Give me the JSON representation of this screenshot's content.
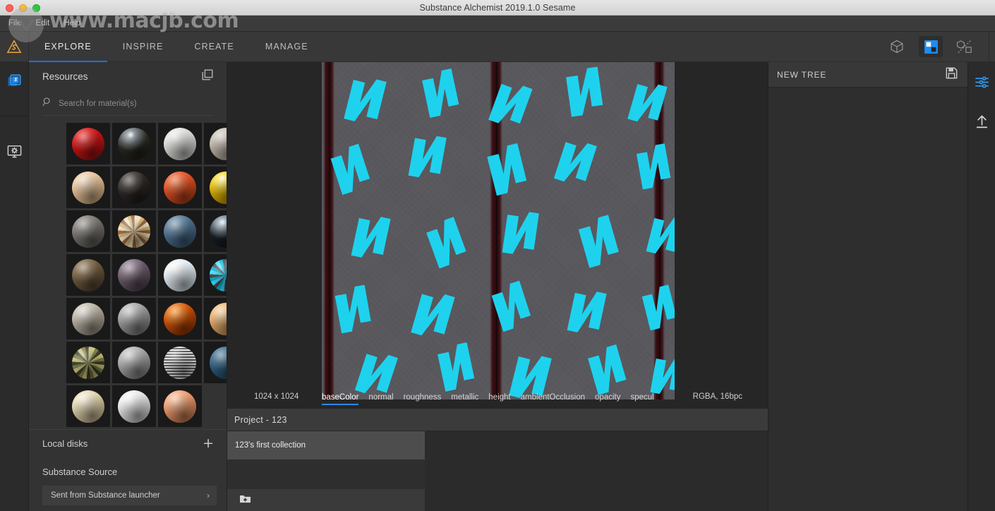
{
  "window": {
    "title": "Substance Alchemist 2019.1.0 Sesame",
    "traffic_lights": [
      "close",
      "minimize",
      "zoom"
    ]
  },
  "watermark": {
    "text": "www.macjb.com"
  },
  "menubar": {
    "items": [
      "File",
      "Edit",
      "Help"
    ]
  },
  "topnav": {
    "brand_icon": "substance-alchemist-logo",
    "tabs": [
      {
        "label": "EXPLORE",
        "active": true
      },
      {
        "label": "INSPIRE",
        "active": false
      },
      {
        "label": "CREATE",
        "active": false
      },
      {
        "label": "MANAGE",
        "active": false
      }
    ],
    "tools": [
      {
        "name": "view-3d-cube-icon",
        "active": false
      },
      {
        "name": "view-2d-texture-icon",
        "active": true
      },
      {
        "name": "view-split-3d-2d-icon",
        "active": false
      }
    ]
  },
  "left_rail": {
    "items": [
      {
        "name": "materials-library-icon",
        "active": true
      },
      {
        "name": "display-settings-icon",
        "active": false
      }
    ]
  },
  "resources": {
    "title": "Resources",
    "duplicate_icon": "duplicate-squares-icon",
    "search": {
      "placeholder": "Search for material(s)",
      "value": "",
      "icon": "search-icon"
    },
    "materials": [
      {
        "name": "red-plastic",
        "colors": [
          "#f03a3a",
          "#c21414",
          "#7a0b0b"
        ],
        "style": "smooth"
      },
      {
        "name": "dark-liquid-metal",
        "colors": [
          "#7f8b93",
          "#2b2a22",
          "#171611"
        ],
        "style": "metal"
      },
      {
        "name": "white-plaster",
        "colors": [
          "#f2f2f0",
          "#d8d8d4",
          "#a9a9a4"
        ],
        "style": "rough"
      },
      {
        "name": "beige-concrete",
        "colors": [
          "#ddd6cd",
          "#bdb2a6",
          "#8d8478"
        ],
        "style": "rough"
      },
      {
        "name": "light-sand",
        "colors": [
          "#f6dcc0",
          "#e3bf96",
          "#b58f67"
        ],
        "style": "rough"
      },
      {
        "name": "dark-charcoal",
        "colors": [
          "#5a534f",
          "#2e2926",
          "#141211"
        ],
        "style": "rough"
      },
      {
        "name": "orange-clay",
        "colors": [
          "#f5774a",
          "#da4f22",
          "#8c2c0f"
        ],
        "style": "smooth"
      },
      {
        "name": "yellow-gold",
        "colors": [
          "#ffe74f",
          "#e0b200",
          "#8e6c00"
        ],
        "style": "metal"
      },
      {
        "name": "gray-stone",
        "colors": [
          "#9d9a93",
          "#76736c",
          "#474541"
        ],
        "style": "rough"
      },
      {
        "name": "patterned-mosaic",
        "colors": [
          "#f2e2bf",
          "#d9b578",
          "#9a6a3c"
        ],
        "style": "pattern"
      },
      {
        "name": "blue-fabric",
        "colors": [
          "#7d9cb5",
          "#4c6f8d",
          "#2a4356"
        ],
        "style": "rough"
      },
      {
        "name": "black-glossy",
        "colors": [
          "#8fa3b2",
          "#1b2229",
          "#070a0d"
        ],
        "style": "metal"
      },
      {
        "name": "brown-dirt",
        "colors": [
          "#9b8464",
          "#6e5a3e",
          "#3b3022"
        ],
        "style": "rough"
      },
      {
        "name": "purple-rock",
        "colors": [
          "#a292a0",
          "#6a5a69",
          "#362e37"
        ],
        "style": "rough"
      },
      {
        "name": "white-snow",
        "colors": [
          "#ffffff",
          "#dfe9ef",
          "#a9b7c0"
        ],
        "style": "rough"
      },
      {
        "name": "cyan-arrows-fabric",
        "colors": [
          "#3ce6ff",
          "#00b6d8",
          "#4a4550"
        ],
        "style": "pattern"
      },
      {
        "name": "light-gravel",
        "colors": [
          "#e0dbd0",
          "#b4ac9d",
          "#77716a"
        ],
        "style": "rough"
      },
      {
        "name": "gray-cement",
        "colors": [
          "#cccccc",
          "#9a9a9a",
          "#5e5e5e"
        ],
        "style": "rough"
      },
      {
        "name": "orange-rust",
        "colors": [
          "#ff9a2e",
          "#c94d07",
          "#5e1f02"
        ],
        "style": "rough"
      },
      {
        "name": "tan-leather",
        "colors": [
          "#ffd6a3",
          "#e0a868",
          "#9a6d38"
        ],
        "style": "rough"
      },
      {
        "name": "mossy-pebbles",
        "colors": [
          "#c7c07a",
          "#7c7e4a",
          "#3d4026"
        ],
        "style": "pattern"
      },
      {
        "name": "plain-gray",
        "colors": [
          "#d2d2d2",
          "#a3a3a3",
          "#646464"
        ],
        "style": "rough"
      },
      {
        "name": "corrugated-stripes",
        "colors": [
          "#e6e6e6",
          "#9c9c9c",
          "#5a5a5a"
        ],
        "style": "stripes"
      },
      {
        "name": "blue-denim",
        "colors": [
          "#5d89a8",
          "#2f5f80",
          "#15303f"
        ],
        "style": "rough"
      },
      {
        "name": "cream-marble",
        "colors": [
          "#fbf3dd",
          "#ddcfa8",
          "#9b8f6d"
        ],
        "style": "rough"
      },
      {
        "name": "white-marble",
        "colors": [
          "#ffffff",
          "#e2e2e2",
          "#a8a8a8"
        ],
        "style": "rough"
      },
      {
        "name": "peach-stucco",
        "colors": [
          "#ffc8a1",
          "#e8966a",
          "#9a5a34"
        ],
        "style": "rough"
      }
    ],
    "local_disks": {
      "label": "Local disks",
      "add_icon": "plus-icon"
    },
    "substance_source": {
      "label": "Substance Source",
      "items": [
        {
          "label": "Sent from Substance launcher",
          "chevron": "chevron-right-icon"
        }
      ]
    }
  },
  "viewport": {
    "dimensions": "1024 x 1024",
    "format": "RGBA, 16bpc",
    "channels": [
      {
        "label": "baseColor",
        "active": true
      },
      {
        "label": "normal",
        "active": false
      },
      {
        "label": "roughness",
        "active": false
      },
      {
        "label": "metallic",
        "active": false
      },
      {
        "label": "height",
        "active": false
      },
      {
        "label": "ambientOcclusion",
        "active": false
      },
      {
        "label": "opacity",
        "active": false
      },
      {
        "label": "specul",
        "active": false,
        "clipped": true
      }
    ],
    "texture": {
      "name": "cyan-arrow-fabric-texture",
      "base_color": "#5b5a60",
      "motif_color": "#1ed2ee",
      "stripe_color": "#9e161e"
    }
  },
  "project": {
    "title": "Project - 123",
    "collections": [
      {
        "label": "123's first collection",
        "selected": true
      }
    ],
    "add_collection_icon": "add-folder-icon"
  },
  "tree": {
    "title": "NEW TREE",
    "save_icon": "save-floppy-icon",
    "layers": []
  },
  "right_rail": {
    "items": [
      {
        "name": "parameters-sliders-icon",
        "active": true
      },
      {
        "name": "export-upload-icon",
        "active": false
      }
    ]
  },
  "colors": {
    "accent_blue": "#1473e6",
    "tab_underline": "#2f86e8",
    "panel_bg": "#333333",
    "window_bg": "#2b2b2b",
    "brand_orange": "#e8a33d"
  }
}
